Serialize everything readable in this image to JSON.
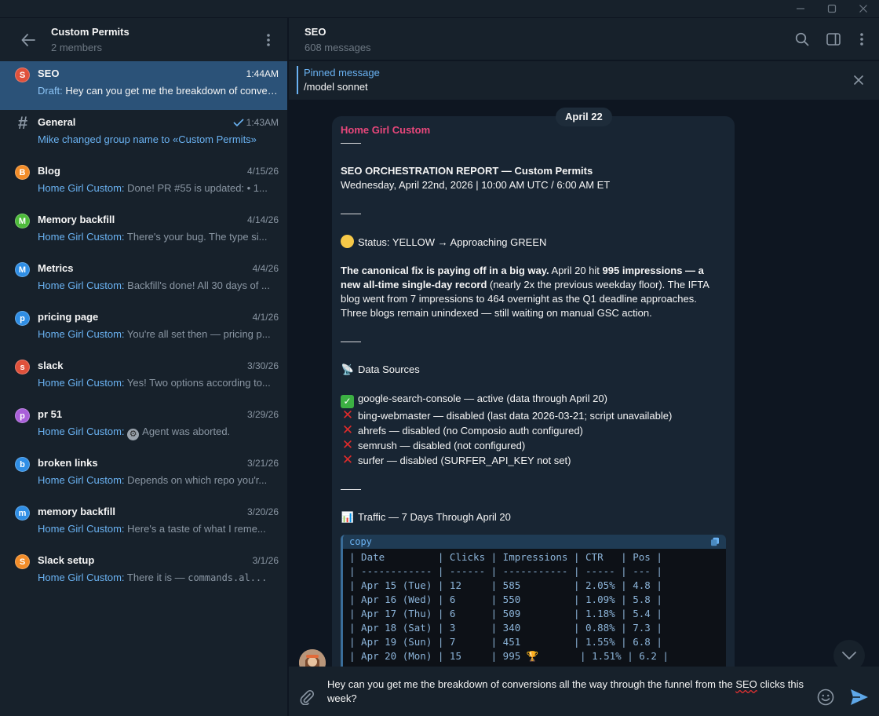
{
  "window": {
    "minimize": "—",
    "maximize": "☐",
    "close": "✕"
  },
  "sidebar": {
    "title": "Custom Permits",
    "subtitle": "2 members",
    "chats": [
      {
        "name": "SEO",
        "time": "1:44AM",
        "draft_label": "Draft:",
        "preview": "Hey can you get me the breakdown of conversions all the way",
        "avatar_letter": "S",
        "avatar_color": "#e0513b"
      },
      {
        "name": "General",
        "time": "1:43AM",
        "preview": "Mike changed group name to «Custom Permits»"
      },
      {
        "name": "Blog",
        "time": "4/15/26",
        "sender": "Home Girl Custom:",
        "preview": "Done! PR #55 is updated: • 1...",
        "avatar_letter": "B",
        "avatar_color": "#f28c28"
      },
      {
        "name": "Memory backfill",
        "time": "4/14/26",
        "sender": "Home Girl Custom:",
        "preview": "There's your bug. The type si...",
        "avatar_letter": "M",
        "avatar_color": "#4dbb3a"
      },
      {
        "name": "Metrics",
        "time": "4/4/26",
        "sender": "Home Girl Custom:",
        "preview": "Backfill's done! All 30 days of ...",
        "avatar_letter": "M",
        "avatar_color": "#2f8ee5"
      },
      {
        "name": "pricing page",
        "time": "4/1/26",
        "sender": "Home Girl Custom:",
        "preview": "You're all set then — pricing p...",
        "avatar_letter": "p",
        "avatar_color": "#2f8ee5"
      },
      {
        "name": "slack",
        "time": "3/30/26",
        "sender": "Home Girl Custom:",
        "preview": "Yes! Two options according to...",
        "avatar_letter": "s",
        "avatar_color": "#e0513b"
      },
      {
        "name": "pr 51",
        "time": "3/29/26",
        "sender": "Home Girl Custom:",
        "preview": "Agent was aborted.",
        "avatar_letter": "p",
        "avatar_color": "#a95fd9"
      },
      {
        "name": "broken links",
        "time": "3/21/26",
        "sender": "Home Girl Custom:",
        "preview": "Depends on which repo you'r...",
        "avatar_letter": "b",
        "avatar_color": "#2f8ee5"
      },
      {
        "name": "memory backfill",
        "time": "3/20/26",
        "sender": "Home Girl Custom:",
        "preview": "Here's a taste of what I reme...",
        "avatar_letter": "m",
        "avatar_color": "#2f8ee5"
      },
      {
        "name": "Slack setup",
        "time": "3/1/26",
        "sender": "Home Girl Custom:",
        "preview_prefix": "There it is — ",
        "preview_code": "commands.al...",
        "avatar_letter": "S",
        "avatar_color": "#f28c28"
      }
    ]
  },
  "header": {
    "title": "SEO",
    "subtitle": "608 messages"
  },
  "pinned": {
    "title": "Pinned message",
    "text": "/model sonnet"
  },
  "message": {
    "date": "April 22",
    "sender": "Home Girl Custom",
    "divider": "——",
    "report_title": "SEO ORCHESTRATION REPORT — Custom Permits",
    "report_date": "Wednesday, April 22nd, 2026 | 10:00 AM UTC / 6:00 AM ET",
    "status": "Status: YELLOW → Approaching GREEN",
    "para_bold1": "The canonical fix is paying off in a big way.",
    "para_t1": " April 20 hit ",
    "para_bold2": "995 impressions — a new all-time single-day record",
    "para_t2": " (nearly 2x the previous weekday floor). The IFTA blog went from 7 impressions to 464 overnight as the Q1 deadline approaches. Three blogs remain unindexed — still waiting on manual GSC action.",
    "sources_title": "Data Sources",
    "sources": [
      "google-search-console — active (data through April 20)",
      "bing-webmaster — disabled (last data 2026-03-21; script unavailable)",
      "ahrefs — disabled (no Composio auth configured)",
      "semrush — disabled (not configured)",
      "surfer — disabled (SURFER_API_KEY not set)"
    ],
    "traffic_title": "Traffic — 7 Days Through April 20",
    "code_label": "copy",
    "code_lines": [
      "| Date         | Clicks | Impressions | CTR   | Pos |",
      "| ------------ | ------ | ----------- | ----- | --- |",
      "| Apr 15 (Tue) | 12     | 585         | 2.05% | 4.8 |",
      "| Apr 16 (Wed) | 6      | 550         | 1.09% | 5.8 |",
      "| Apr 17 (Thu) | 6      | 509         | 1.18% | 5.4 |",
      "| Apr 18 (Sat) | 3      | 340         | 0.88% | 7.3 |",
      "| Apr 19 (Sun) | 7      | 451         | 1.55% | 6.8 |",
      "| Apr 20 (Mon) | 15     | 995 🏆       | 1.51% | 6.2 |"
    ]
  },
  "composer": {
    "text_before": "Hey can you get me the breakdown of conversions all the way through the funnel from the ",
    "text_misspelled": "SEO",
    "text_after": " clicks this week?"
  }
}
